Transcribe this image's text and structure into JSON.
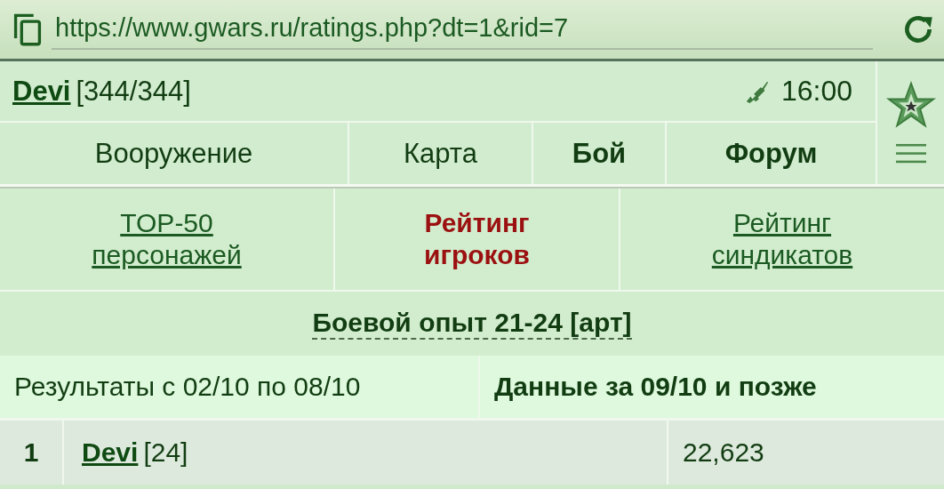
{
  "address_bar": {
    "url": "https://www.gwars.ru/ratings.php?dt=1&rid=7"
  },
  "header": {
    "player_name": "Devi",
    "player_hp": "[344/344]",
    "time": "16:00"
  },
  "nav": [
    {
      "label": "Вооружение",
      "bold": false
    },
    {
      "label": "Карта",
      "bold": false
    },
    {
      "label": "Бой",
      "bold": true
    },
    {
      "label": "Форум",
      "bold": true
    }
  ],
  "tabs": [
    {
      "label": "TOP-50 персонажей",
      "selected": false
    },
    {
      "label": "Рейтинг игроков",
      "selected": true
    },
    {
      "label": "Рейтинг синдикатов",
      "selected": false
    }
  ],
  "rating_title": "Боевой опыт 21-24 [арт]",
  "periods": [
    {
      "label": "Результаты с 02/10 по 08/10",
      "selected": false
    },
    {
      "label": "Данные за 09/10 и позже",
      "selected": true
    }
  ],
  "rows": [
    {
      "rank": "1",
      "name": "Devi",
      "bracket": "[24]",
      "value": "22,623"
    }
  ]
}
